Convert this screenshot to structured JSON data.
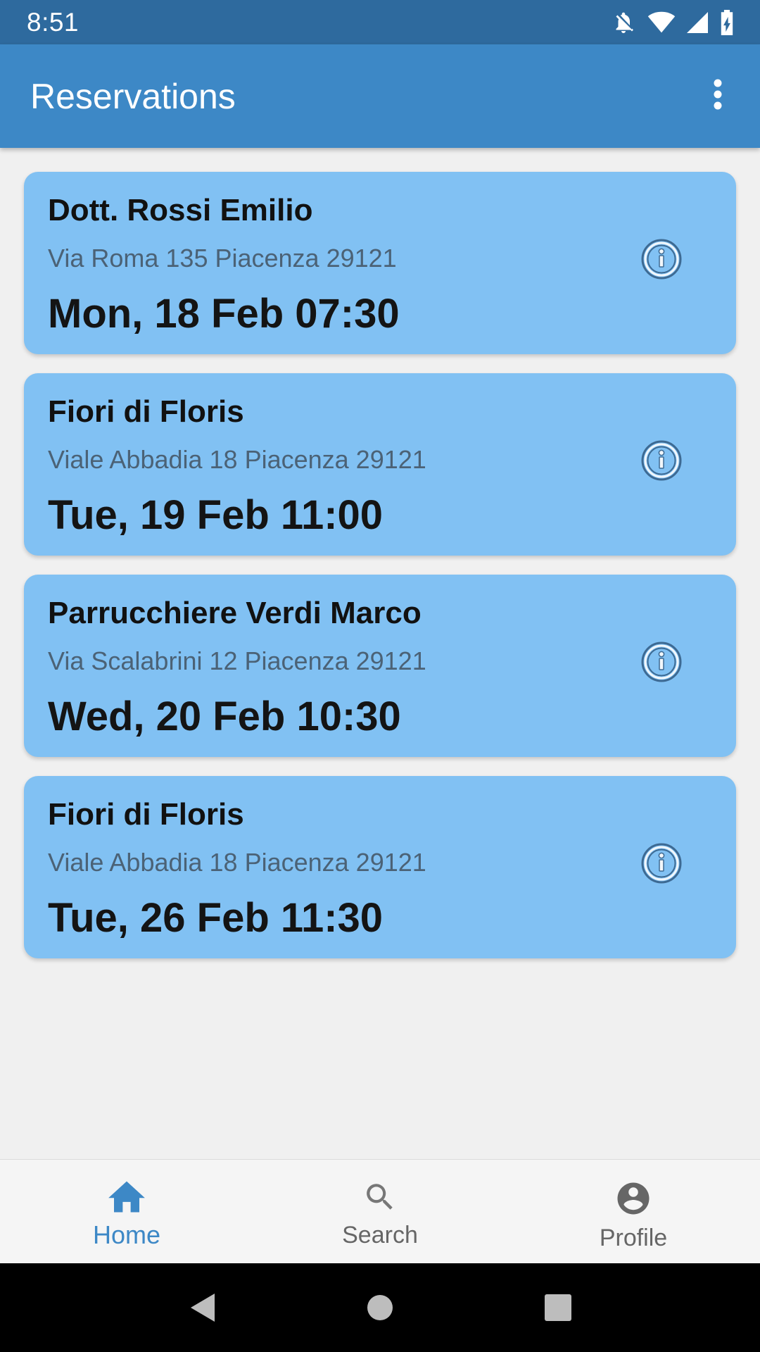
{
  "status_bar": {
    "time": "8:51",
    "icons": [
      "notifications-off-icon",
      "wifi-icon",
      "cell-signal-icon",
      "battery-charging-icon"
    ]
  },
  "app_bar": {
    "title": "Reservations",
    "overflow_icon": "more-vert-icon"
  },
  "reservations": [
    {
      "name": "Dott. Rossi Emilio",
      "address": "Via Roma 135 Piacenza 29121",
      "date": "Mon, 18 Feb 07:30"
    },
    {
      "name": "Fiori di Floris",
      "address": "Viale Abbadia 18 Piacenza 29121",
      "date": "Tue, 19 Feb 11:00"
    },
    {
      "name": "Parrucchiere Verdi Marco",
      "address": "Via Scalabrini 12 Piacenza 29121",
      "date": "Wed, 20 Feb 10:30"
    },
    {
      "name": "Fiori di Floris",
      "address": "Viale Abbadia 18 Piacenza 29121",
      "date": "Tue, 26 Feb 11:30"
    }
  ],
  "bottom_nav": {
    "items": [
      {
        "label": "Home",
        "icon": "home-icon",
        "active": true
      },
      {
        "label": "Search",
        "icon": "search-icon",
        "active": false
      },
      {
        "label": "Profile",
        "icon": "account-circle-icon",
        "active": false
      }
    ]
  },
  "colors": {
    "status_bar": "#2e6a9e",
    "app_bar": "#3d88c6",
    "card": "#81c1f3",
    "accent": "#3d88c6"
  }
}
